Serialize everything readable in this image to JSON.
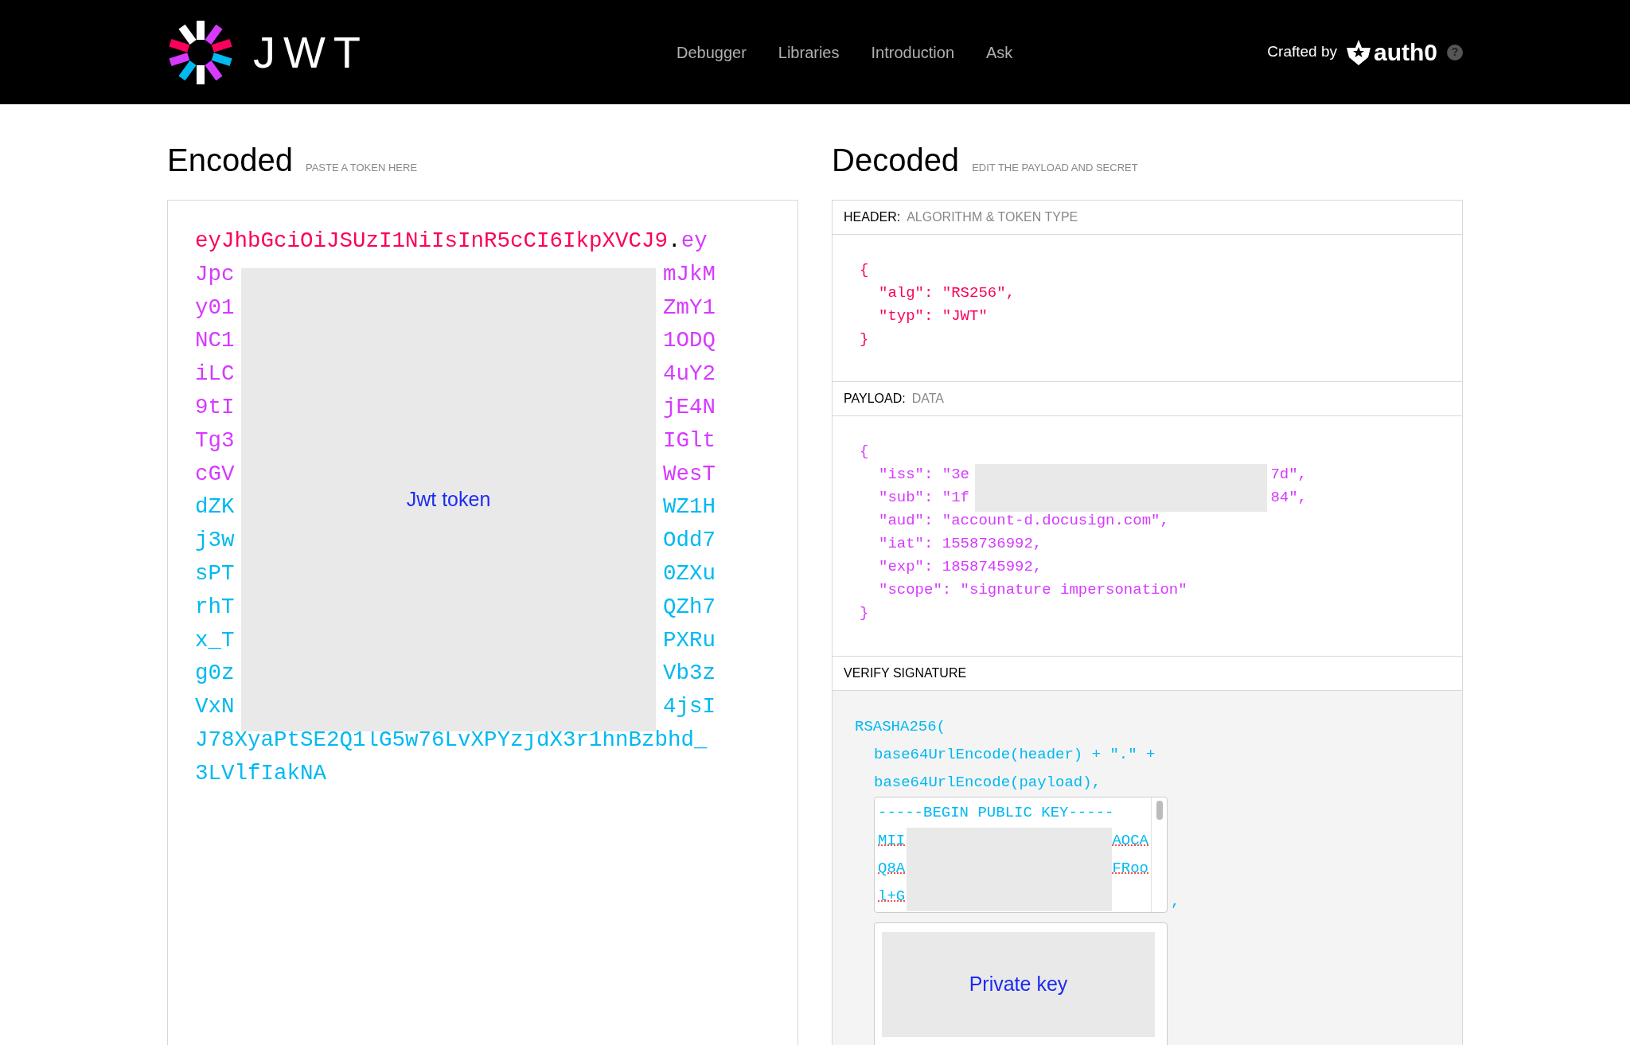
{
  "nav": {
    "logo_text": "JWT",
    "links": [
      {
        "label": "Debugger"
      },
      {
        "label": "Libraries"
      },
      {
        "label": "Introduction"
      },
      {
        "label": "Ask"
      }
    ],
    "crafted_by": "Crafted by",
    "brand": "auth0",
    "help": "?"
  },
  "encoded": {
    "title": "Encoded",
    "hint": "PASTE A TOKEN HERE",
    "lines": [
      {
        "left": [
          {
            "text": "eyJhbGciOiJSUzI1NiIsInR5cCI6IkpXVCJ9",
            "kind": "header"
          },
          {
            "text": ".",
            "kind": "dot"
          },
          {
            "text": "ey",
            "kind": "payload"
          }
        ]
      },
      {
        "left": [
          {
            "text": "Jpc",
            "kind": "payload"
          }
        ],
        "right": [
          {
            "text": "mJkM",
            "kind": "payload"
          }
        ]
      },
      {
        "left": [
          {
            "text": "y01",
            "kind": "payload"
          }
        ],
        "right": [
          {
            "text": "ZmY1",
            "kind": "payload"
          }
        ]
      },
      {
        "left": [
          {
            "text": "NC1",
            "kind": "payload"
          }
        ],
        "right": [
          {
            "text": "1ODQ",
            "kind": "payload"
          }
        ]
      },
      {
        "left": [
          {
            "text": "iLC",
            "kind": "payload"
          }
        ],
        "right": [
          {
            "text": "4uY2",
            "kind": "payload"
          }
        ]
      },
      {
        "left": [
          {
            "text": "9tI",
            "kind": "payload"
          }
        ],
        "right": [
          {
            "text": "jE4N",
            "kind": "payload"
          }
        ]
      },
      {
        "left": [
          {
            "text": "Tg3",
            "kind": "payload"
          }
        ],
        "right": [
          {
            "text": "IGlt",
            "kind": "payload"
          }
        ]
      },
      {
        "left": [
          {
            "text": "cGV",
            "kind": "payload"
          }
        ],
        "right": [
          {
            "text": "WesT",
            "kind": "payload"
          }
        ]
      },
      {
        "left": [
          {
            "text": "dZK",
            "kind": "signature"
          }
        ],
        "right": [
          {
            "text": "WZ1H",
            "kind": "signature"
          }
        ]
      },
      {
        "left": [
          {
            "text": "j3w",
            "kind": "signature"
          }
        ],
        "right": [
          {
            "text": "Odd7",
            "kind": "signature"
          }
        ]
      },
      {
        "left": [
          {
            "text": "sPT",
            "kind": "signature"
          }
        ],
        "right": [
          {
            "text": "0ZXu",
            "kind": "signature"
          }
        ]
      },
      {
        "left": [
          {
            "text": "rhT",
            "kind": "signature"
          }
        ],
        "right": [
          {
            "text": "QZh7",
            "kind": "signature"
          }
        ]
      },
      {
        "left": [
          {
            "text": "x_T",
            "kind": "signature"
          }
        ],
        "right": [
          {
            "text": "PXRu",
            "kind": "signature"
          }
        ]
      },
      {
        "left": [
          {
            "text": "g0z",
            "kind": "signature"
          }
        ],
        "right": [
          {
            "text": "Vb3z",
            "kind": "signature"
          }
        ]
      },
      {
        "left": [
          {
            "text": "VxN",
            "kind": "signature"
          }
        ],
        "right": [
          {
            "text": "4jsI",
            "kind": "signature"
          }
        ]
      },
      {
        "left": [
          {
            "text": "J78XyaPtSE2Q1lG5w76LvXPYzjdX3r1hnBzbhd_",
            "kind": "signature"
          }
        ]
      },
      {
        "left": [
          {
            "text": "3LVlfIakNA",
            "kind": "signature"
          }
        ]
      }
    ],
    "redaction": "Jwt token"
  },
  "decoded": {
    "title": "Decoded",
    "hint": "EDIT THE PAYLOAD AND SECRET",
    "header": {
      "label": "HEADER:",
      "hint": "ALGORITHM & TOKEN TYPE",
      "lines": [
        {
          "kind": "brace",
          "left": "{"
        },
        {
          "kind": "entry",
          "left": "\"alg\": \"RS256\","
        },
        {
          "kind": "entry",
          "left": "\"typ\": \"JWT\""
        },
        {
          "kind": "brace",
          "left": "}"
        }
      ]
    },
    "payload": {
      "label": "PAYLOAD:",
      "hint": "DATA",
      "lines": [
        {
          "kind": "brace",
          "left": "{"
        },
        {
          "kind": "entry",
          "left": "\"iss\": \"3e",
          "right": "7d\","
        },
        {
          "kind": "entry",
          "left": "\"sub\": \"1f",
          "right": "84\","
        },
        {
          "kind": "entry",
          "left": "\"aud\": \"account-d.docusign.com\","
        },
        {
          "kind": "entry",
          "left": "\"iat\": 1558736992,"
        },
        {
          "kind": "entry",
          "left": "\"exp\": 1858745992,"
        },
        {
          "kind": "entry",
          "left": "\"scope\": \"signature impersonation\""
        },
        {
          "kind": "brace",
          "left": "}"
        }
      ]
    },
    "verify": {
      "label": "VERIFY SIGNATURE",
      "code": [
        {
          "kind": "brace",
          "left": "RSASHA256("
        },
        {
          "kind": "entry",
          "left": "base64UrlEncode(header) + \".\" +"
        },
        {
          "kind": "entry",
          "left": "base64UrlEncode(payload),"
        }
      ],
      "public_key": [
        {
          "left": "-----BEGIN PUBLIC KEY-----"
        },
        {
          "left": "MII",
          "right": "AOCA"
        },
        {
          "left": "Q8A",
          "right": "FRoo"
        },
        {
          "left": "l+G"
        }
      ],
      "separator": ",",
      "private_key_redaction": "Private key"
    }
  }
}
